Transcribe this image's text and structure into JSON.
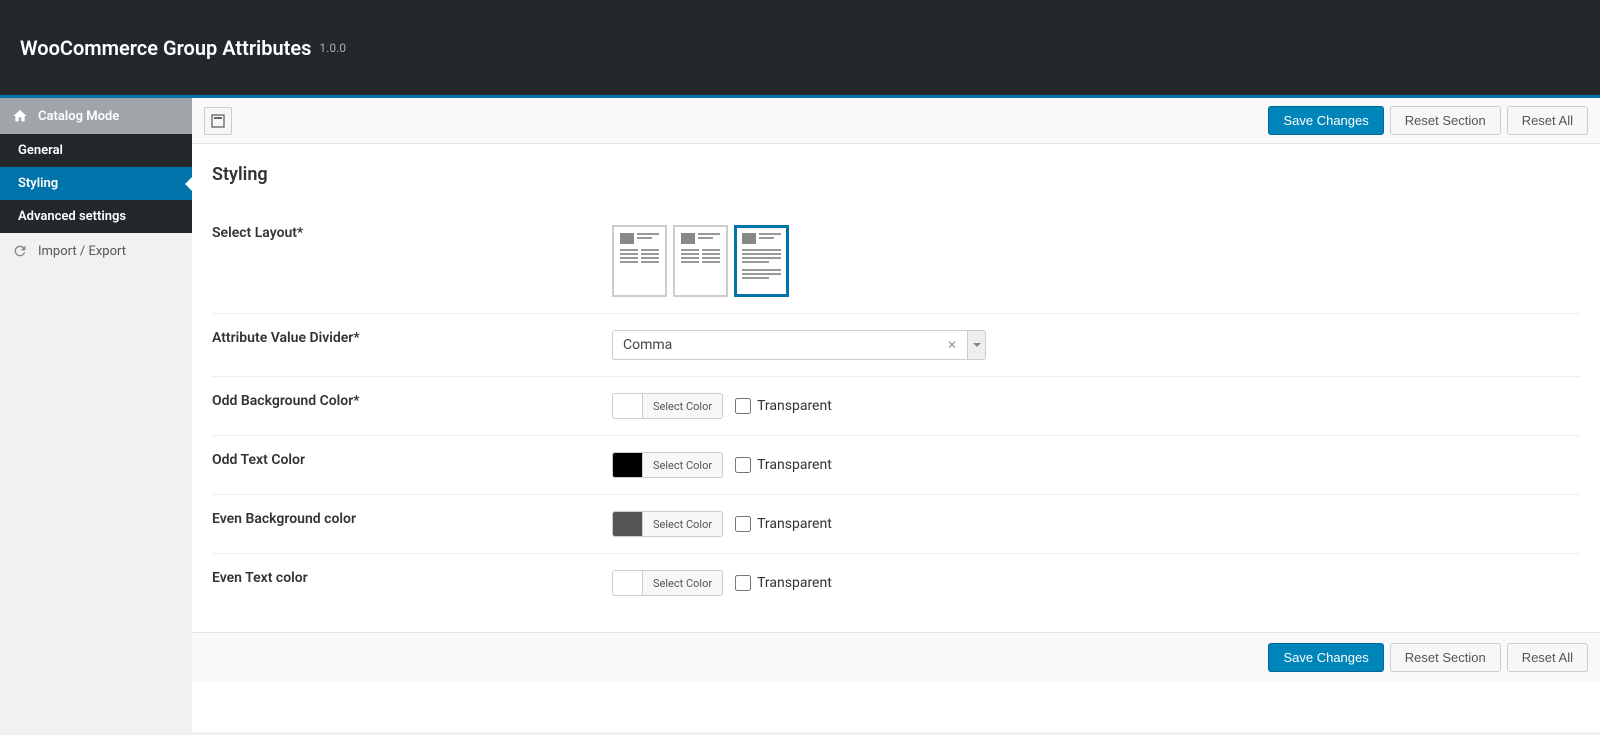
{
  "header": {
    "title": "WooCommerce Group Attributes",
    "version": "1.0.0"
  },
  "sidebar": {
    "section_label": "Catalog Mode",
    "items": [
      {
        "label": "General"
      },
      {
        "label": "Styling"
      },
      {
        "label": "Advanced settings"
      }
    ],
    "import_export": "Import / Export"
  },
  "toolbar": {
    "save_label": "Save Changes",
    "reset_section_label": "Reset Section",
    "reset_all_label": "Reset All"
  },
  "section": {
    "title": "Styling"
  },
  "fields": {
    "select_layout": {
      "label": "Select Layout*"
    },
    "divider": {
      "label": "Attribute Value Divider*",
      "value": "Comma"
    },
    "odd_bg": {
      "label": "Odd Background Color*",
      "select_color": "Select Color",
      "transparent": "Transparent",
      "swatch": "#ffffff"
    },
    "odd_text": {
      "label": "Odd Text Color",
      "select_color": "Select Color",
      "transparent": "Transparent",
      "swatch": "#000000"
    },
    "even_bg": {
      "label": "Even Background color",
      "select_color": "Select Color",
      "transparent": "Transparent",
      "swatch": "#555555"
    },
    "even_text": {
      "label": "Even Text color",
      "select_color": "Select Color",
      "transparent": "Transparent",
      "swatch": "#ffffff"
    }
  }
}
